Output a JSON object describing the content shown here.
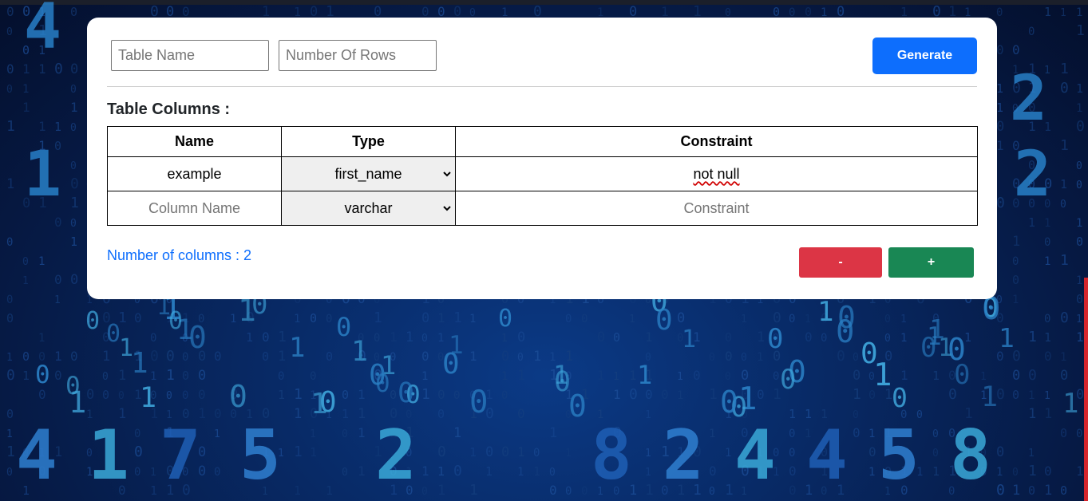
{
  "form": {
    "table_name_placeholder": "Table Name",
    "row_count_placeholder": "Number Of Rows",
    "generate_label": "Generate"
  },
  "columns_section": {
    "title": "Table Columns :",
    "headers": [
      "Name",
      "Type",
      "Constraint"
    ],
    "rows": [
      {
        "name": "example",
        "name_placeholder": "Column Name",
        "type": "first_name",
        "constraint": "not null",
        "constraint_placeholder": "Constraint"
      },
      {
        "name": "",
        "name_placeholder": "Column Name",
        "type": "varchar",
        "constraint": "",
        "constraint_placeholder": "Constraint"
      }
    ]
  },
  "footer": {
    "column_count_text": "Number of columns : 2",
    "remove_label": "-",
    "add_label": "+"
  },
  "colors": {
    "primary": "#0d6efd",
    "danger": "#dc3545",
    "success": "#198754"
  },
  "background_digits": {
    "big": [
      "4",
      "1",
      "7",
      "5",
      "2",
      "8",
      "2",
      "4",
      "4",
      "5",
      "8",
      "1",
      "0",
      "0",
      "0",
      "1",
      "1",
      "0",
      "0",
      "0",
      "1",
      "1",
      "0",
      "1",
      "0",
      "0",
      "1"
    ],
    "small": "01"
  }
}
